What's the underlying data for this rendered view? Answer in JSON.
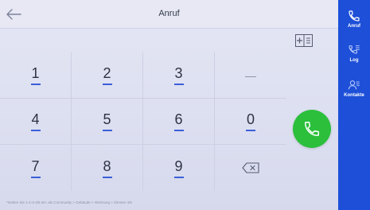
{
  "header": {
    "title": "Anruf",
    "back_icon": "arrow-left-icon"
  },
  "toolbar": {
    "list_icon": "contact-list-toggle-icon"
  },
  "keypad": {
    "keys": [
      {
        "label": "1"
      },
      {
        "label": "2"
      },
      {
        "label": "3"
      },
      {
        "label": "—"
      },
      {
        "label": "4"
      },
      {
        "label": "5"
      },
      {
        "label": "6"
      },
      {
        "label": "0"
      },
      {
        "label": "7"
      },
      {
        "label": "8"
      },
      {
        "label": "9"
      },
      {
        "label": "backspace"
      }
    ]
  },
  "call_button": {
    "icon": "phone-icon",
    "color": "#2bbf3c"
  },
  "footer": {
    "hint": "*Geben Sie 1-2-3-4/5 ein: als Community > Gebäude > Wohnung > Zimmer 4/5"
  },
  "sidebar": {
    "color": "#1d4fd8",
    "items": [
      {
        "label": "Anruf",
        "icon": "phone-icon",
        "active": true
      },
      {
        "label": "Log",
        "icon": "call-log-icon",
        "active": false
      },
      {
        "label": "Kontakte",
        "icon": "contacts-icon",
        "active": false
      }
    ]
  }
}
